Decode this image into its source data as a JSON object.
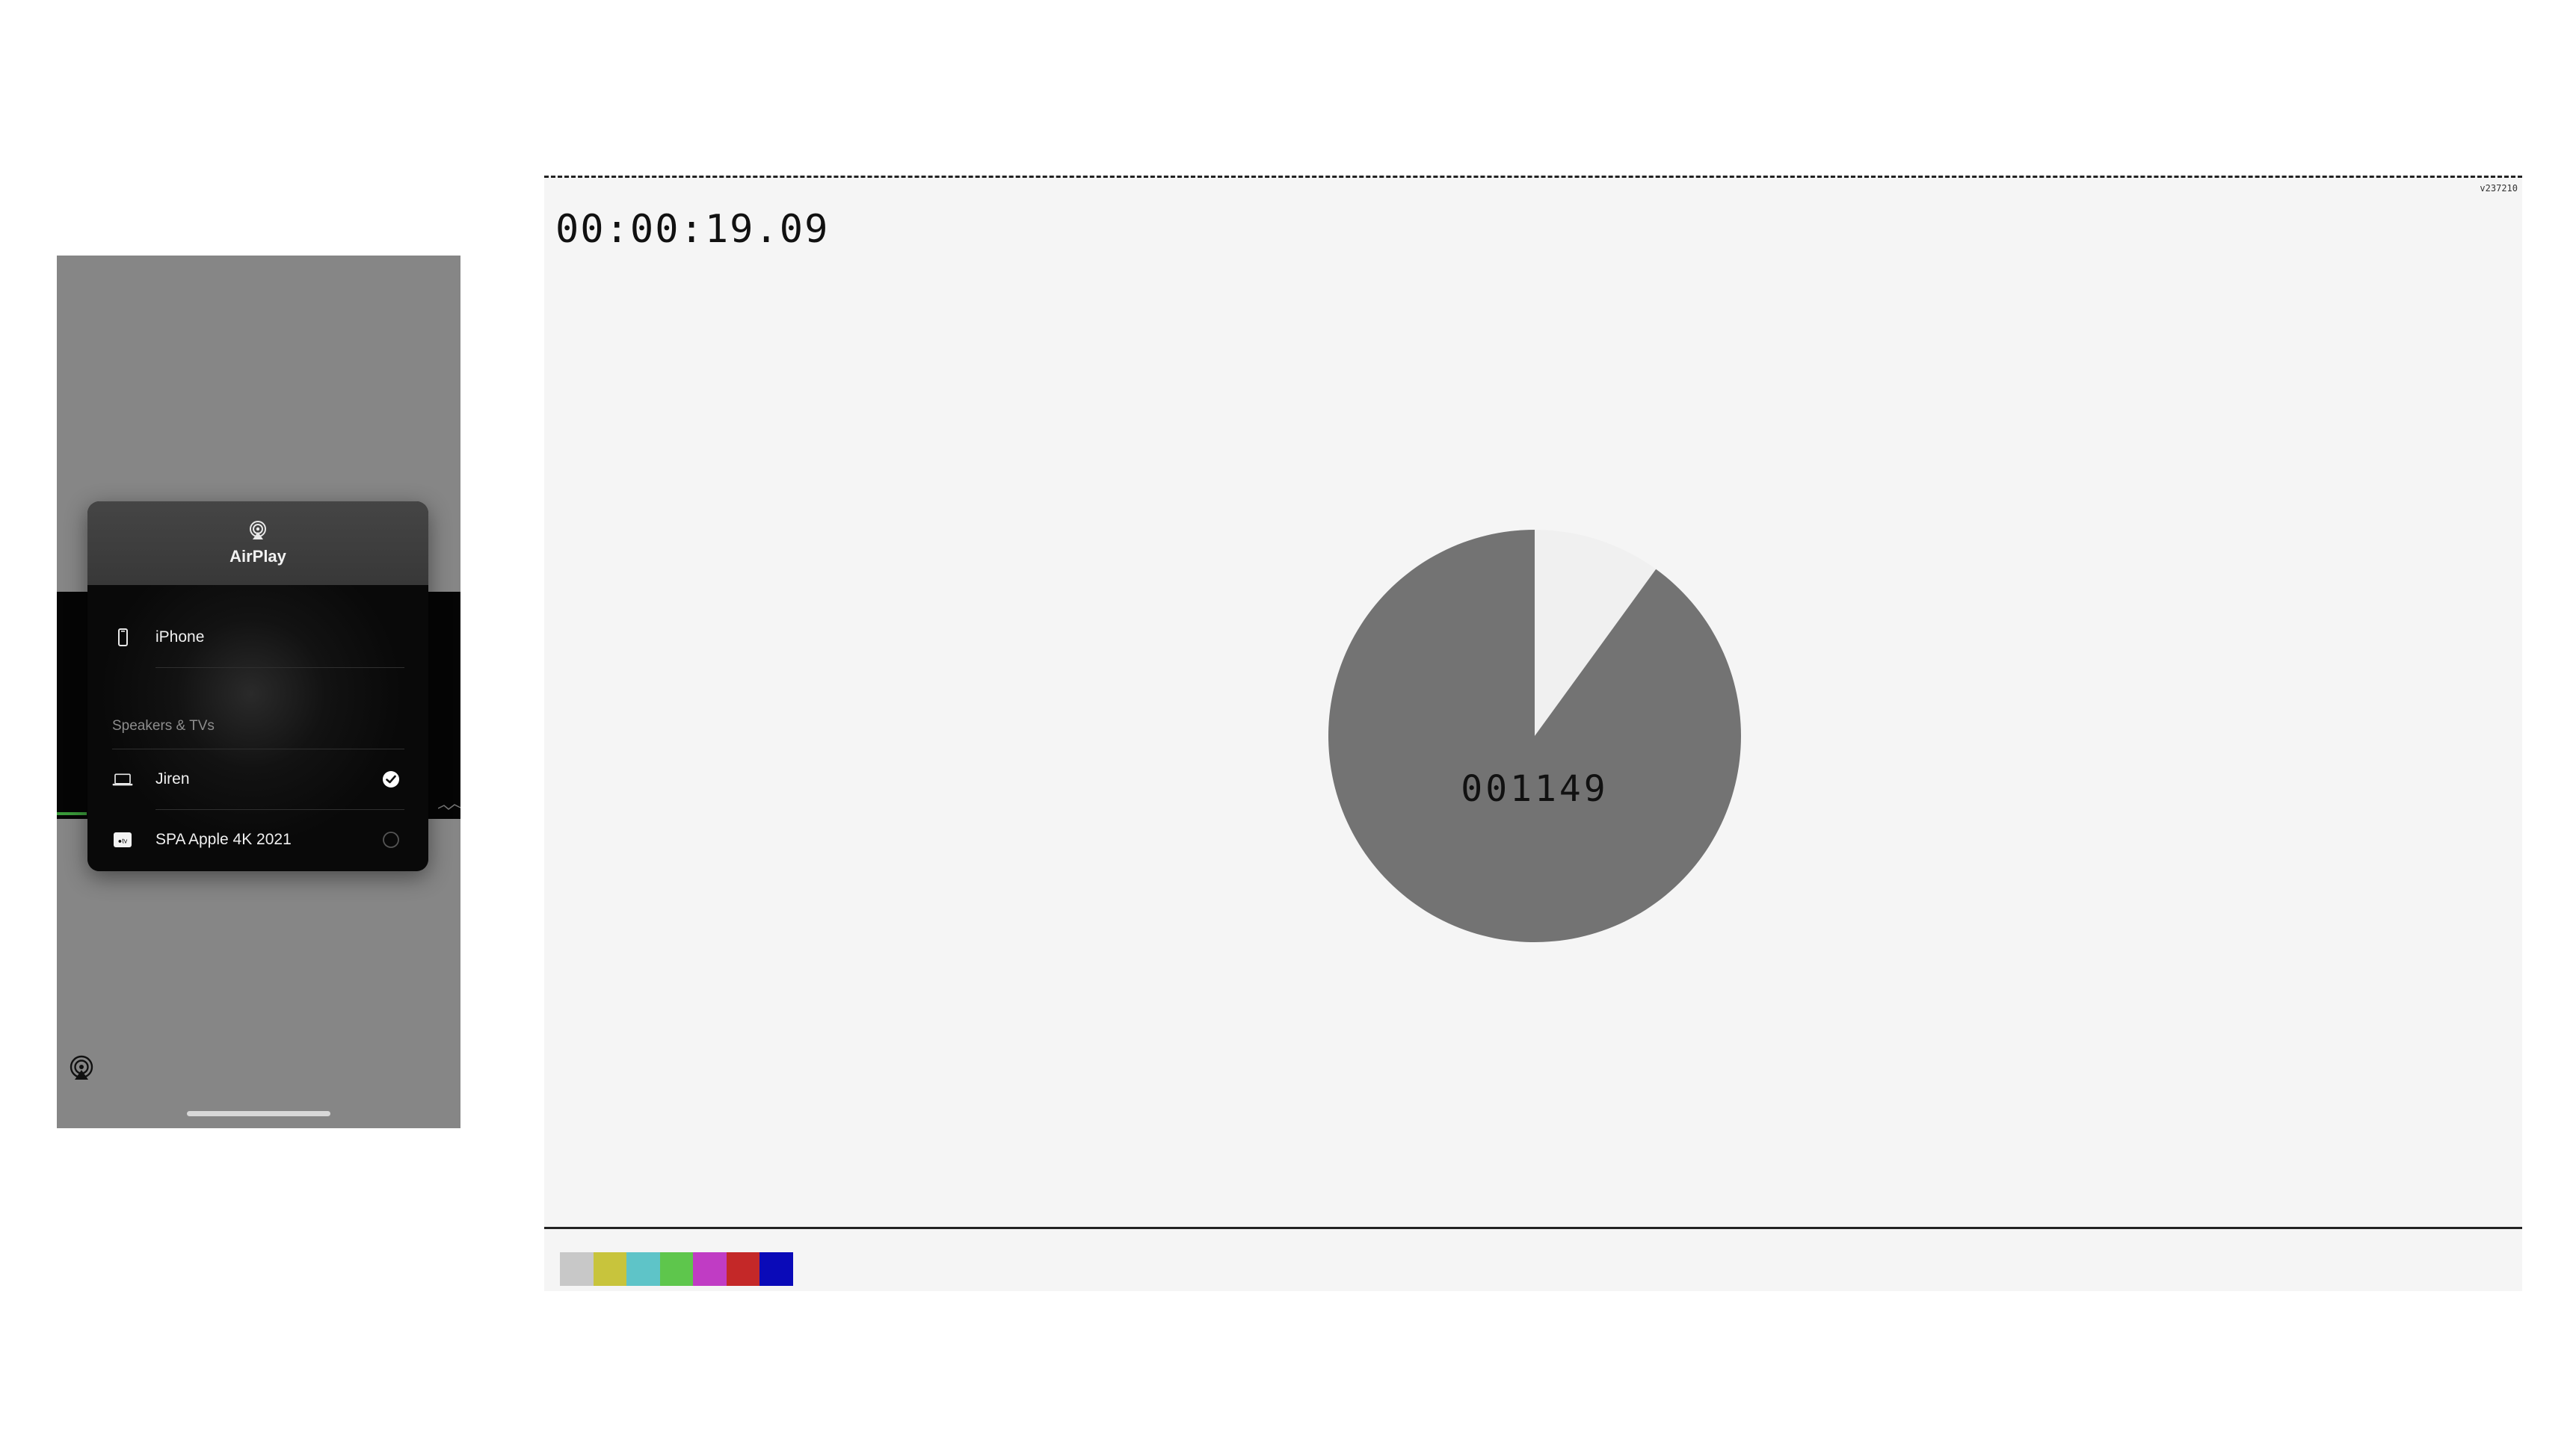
{
  "phone": {
    "airplay_sheet": {
      "title": "AirPlay",
      "device_row": {
        "label": "iPhone",
        "icon": "iphone-icon"
      },
      "section_label": "Speakers & TVs",
      "speakers": [
        {
          "label": "Jiren",
          "icon": "laptop-icon",
          "selected": true
        },
        {
          "label": "SPA Apple 4K 2021",
          "icon": "appletv-icon",
          "selected": false
        }
      ]
    },
    "accent_color": "#ffffff"
  },
  "test_pattern": {
    "timecode": "00:00:19.09",
    "frame_counter": "001149",
    "version_label": "v237210",
    "pie_progress": 0.9,
    "pie_fill_color": "#737373",
    "pie_bg_color": "#f0f0f0",
    "color_bars": [
      "#c8c8c8",
      "#c8c43c",
      "#5ec4c8",
      "#5ec64c",
      "#c03cc4",
      "#c42828",
      "#0a0ab8"
    ]
  }
}
